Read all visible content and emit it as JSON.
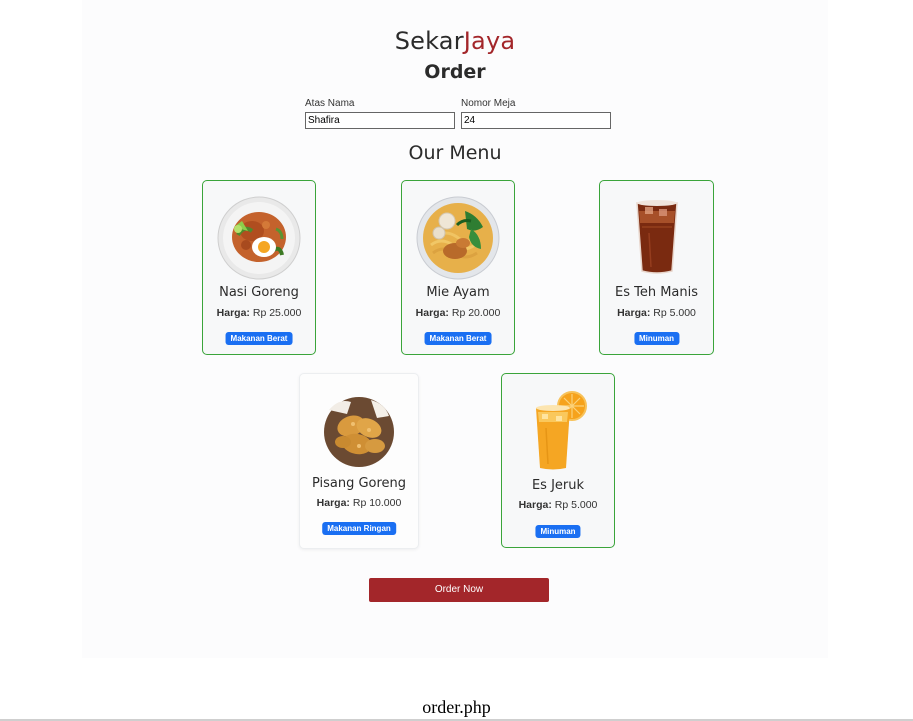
{
  "header": {
    "brand_part1": "Sekar",
    "brand_part2": "Jaya",
    "title": "Order"
  },
  "form": {
    "atas_nama": {
      "label": "Atas Nama",
      "value": "Shafira"
    },
    "nomor_meja": {
      "label": "Nomor Meja",
      "value": "24"
    }
  },
  "menu": {
    "title": "Our Menu",
    "price_label": "Harga:",
    "items": [
      {
        "name": "Nasi Goreng",
        "price": "Rp 25.000",
        "category": "Makanan Berat",
        "selected": true,
        "image": "nasi-goreng-plate"
      },
      {
        "name": "Mie Ayam",
        "price": "Rp 20.000",
        "category": "Makanan Berat",
        "selected": true,
        "image": "mie-ayam-bowl"
      },
      {
        "name": "Es Teh Manis",
        "price": "Rp 5.000",
        "category": "Minuman",
        "selected": true,
        "image": "iced-tea-glass"
      },
      {
        "name": "Pisang Goreng",
        "price": "Rp 10.000",
        "category": "Makanan Ringan",
        "selected": false,
        "image": "pisang-goreng-basket"
      },
      {
        "name": "Es Jeruk",
        "price": "Rp 5.000",
        "category": "Minuman",
        "selected": true,
        "image": "orange-juice-cup"
      }
    ]
  },
  "actions": {
    "order_label": "Order Now"
  },
  "caption": "order.php",
  "colors": {
    "brand_accent": "#a3262a",
    "selected_border": "#3aa43a",
    "badge": "#1a6ff2",
    "button": "#a3262a"
  }
}
